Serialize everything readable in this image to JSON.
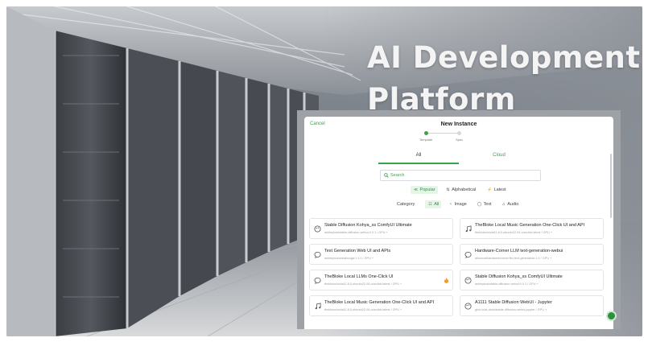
{
  "hero": {
    "title_line1": "AI Development",
    "title_line2": "Platform"
  },
  "dialog": {
    "cancel_label": "Cancel",
    "title": "New Instance",
    "steps": [
      "Template",
      "Spec"
    ],
    "tabs": [
      "All",
      "Cloud"
    ],
    "search_placeholder": "Search",
    "sort_options": [
      {
        "label": "Popular",
        "icon": "popular-icon",
        "selected": true
      },
      {
        "label": "Alphabetical",
        "icon": "sort-alpha-icon",
        "selected": false
      },
      {
        "label": "Latest",
        "icon": "latest-icon",
        "selected": false
      }
    ],
    "category_label": "Category",
    "categories": [
      {
        "label": "All",
        "icon": "grid-icon",
        "selected": true
      },
      {
        "label": "Image",
        "icon": "image-icon",
        "selected": false
      },
      {
        "label": "Text",
        "icon": "chat-icon",
        "selected": false
      },
      {
        "label": "Audio",
        "icon": "music-icon",
        "selected": false
      }
    ],
    "templates": [
      {
        "title": "Stable Diffusion Kohya_ss ComfyUI Ultimate",
        "subtitle": "ashleykza/stable-diffusion-webui:4.0.1 / GPU +",
        "icon": "palette-icon"
      },
      {
        "title": "TheBloke Local Music Generation One-Click UI and API",
        "subtitle": "thebloke/cuda11.8.0-ubuntu22.04-oneclick:latest / GPU +",
        "icon": "music-icon"
      },
      {
        "title": "Text Generation Web UI and APIs",
        "subtitle": "ashleykza/oobabooga:1.1.0 / GPU +",
        "icon": "chat-icon"
      },
      {
        "title": "Hardware-Corner LLM text-generation-webui",
        "subtitle": "alfonzoelhardwarecorner/llm-text-generation:1.0 / GPU +",
        "icon": "chat-icon"
      },
      {
        "title": "TheBloke Local LLMs One-Click UI",
        "subtitle": "thebloke/cuda11.8.0-ubuntu22.04-oneclick:latest / GPU +",
        "icon": "chat-icon",
        "hot": true
      },
      {
        "title": "Stable Diffusion Kohya_ss ComfyUI Ultimate",
        "subtitle": "ashleykza/stable-diffusion-webui:4.0.1 / GPU +",
        "icon": "palette-icon"
      },
      {
        "title": "TheBloke Local Music Generation One-Click UI and API",
        "subtitle": "thebloke/cuda11.8.0-ubuntu22.04-oneclick:latest / GPU +",
        "icon": "music-icon"
      },
      {
        "title": "A1111 Stable Diffusion WebUI - Jupyter",
        "subtitle": "ghcr.io/ai-dock/stable-diffusion-webui:jupyter / GPU +",
        "icon": "palette-icon"
      }
    ]
  },
  "colors": {
    "accent": "#3aa34a",
    "overlay": "#9ea1a6"
  }
}
